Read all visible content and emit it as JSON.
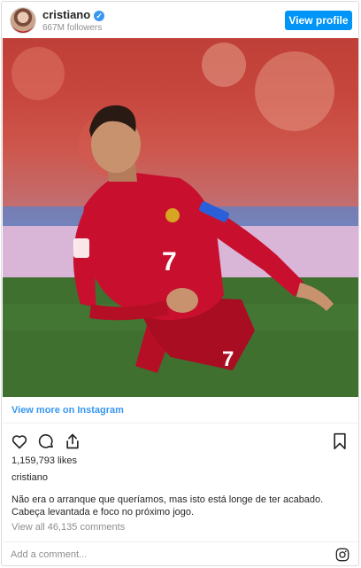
{
  "header": {
    "username": "cristiano",
    "verified_mark": "✓",
    "followers": "667M followers",
    "view_profile_label": "View profile"
  },
  "post": {
    "view_more_label": "View more on Instagram",
    "likes": "1,159,793 likes",
    "caption_user": "cristiano",
    "caption": "Não era o arranque que queríamos, mas isto está longe de ter acabado. Cabeça levantada e foco no próximo jogo.",
    "comments_link": "View all 46,135 comments",
    "jersey_number": "7",
    "comment_placeholder": "Add a comment..."
  },
  "icons": {
    "like": "heart-icon",
    "comment": "comment-icon",
    "share": "share-icon",
    "save": "bookmark-icon",
    "instagram": "instagram-icon"
  },
  "colors": {
    "accent": "#0095f6",
    "link": "#3897f0",
    "muted": "#8e8e8e",
    "jersey": "#c8102e"
  }
}
